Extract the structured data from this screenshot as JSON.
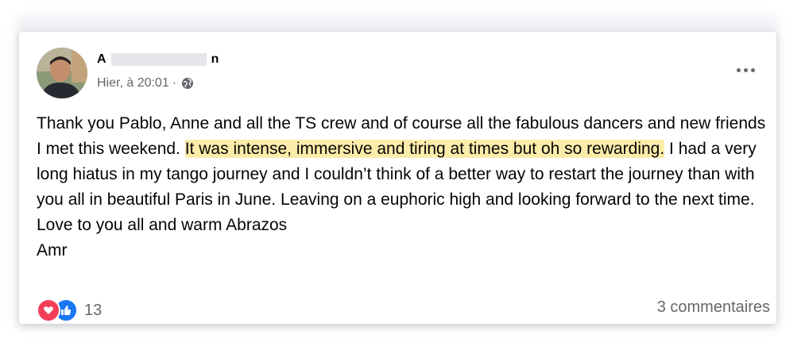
{
  "post": {
    "author": {
      "name_start": "A",
      "name_end": "n"
    },
    "timestamp": "Hier, à 20:01",
    "separator": "·",
    "audience_icon": "globe-icon",
    "more_icon": "more-options-icon",
    "body": {
      "part1": "Thank you Pablo, Anne and all the TS crew and of course all the fabulous dancers and new friends I met this weekend. ",
      "highlight": "It was intense, immersive and tiring at times but oh so rewarding.",
      "part2": " I had a very long hiatus in my tango journey and I couldn’t think of a better way to restart the journey than with you all in beautiful Paris in June. Leaving on a euphoric high and looking forward to the next time.",
      "line2": "Love to you all and warm Abrazos",
      "line3": "Amr"
    },
    "reactions": {
      "icons": [
        "love-icon",
        "like-icon"
      ],
      "count": "13"
    },
    "comments": "3 commentaires"
  },
  "colors": {
    "highlight": "#fcecaa",
    "secondary_text": "#65676b",
    "love": "#f33e58",
    "like": "#1877f2"
  }
}
